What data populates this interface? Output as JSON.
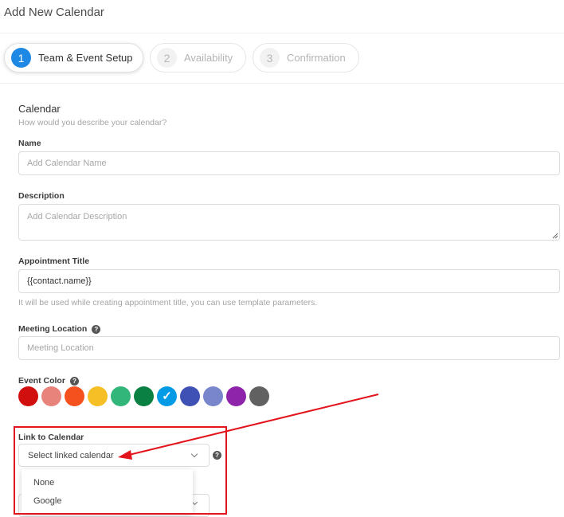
{
  "page": {
    "title": "Add New Calendar"
  },
  "steps": [
    {
      "number": "1",
      "label": "Team & Event Setup",
      "active": true
    },
    {
      "number": "2",
      "label": "Availability",
      "active": false
    },
    {
      "number": "3",
      "label": "Confirmation",
      "active": false
    }
  ],
  "section": {
    "title": "Calendar",
    "subtitle": "How would you describe your calendar?"
  },
  "fields": {
    "name": {
      "label": "Name",
      "placeholder": "Add Calendar Name",
      "value": ""
    },
    "description": {
      "label": "Description",
      "placeholder": "Add Calendar Description",
      "value": ""
    },
    "appointment_title": {
      "label": "Appointment Title",
      "value": "{{contact.name}}",
      "hint": "It will be used while creating appointment title, you can use template parameters."
    },
    "meeting_location": {
      "label": "Meeting Location",
      "placeholder": "Meeting Location",
      "value": ""
    },
    "event_color": {
      "label": "Event Color",
      "colors": [
        "#d20f0f",
        "#e8837c",
        "#f4511e",
        "#f6bf26",
        "#33b679",
        "#0b8043",
        "#039be5",
        "#3f51b5",
        "#7986cb",
        "#8e24aa",
        "#616161"
      ],
      "selected_index": 6
    },
    "link_to_calendar": {
      "label": "Link to Calendar",
      "selected": "Select linked calendar",
      "options": [
        "None",
        "Google"
      ]
    }
  },
  "icons": {
    "help": "question-circle-icon",
    "chevron": "chevron-down-icon",
    "check": "check-icon"
  },
  "annotation": {
    "color": "#e3141b"
  }
}
